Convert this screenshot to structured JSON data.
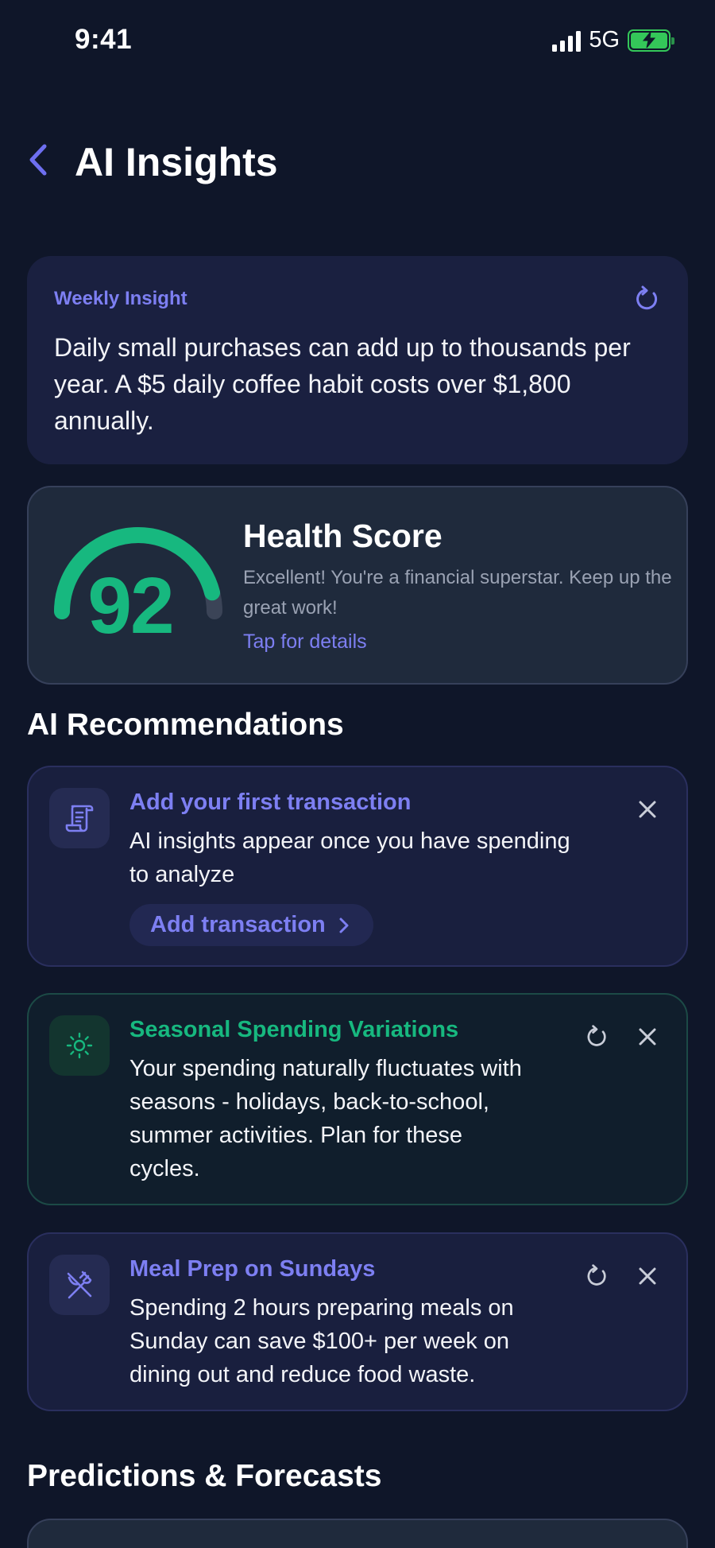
{
  "status_bar": {
    "time": "9:41",
    "network": "5G"
  },
  "header": {
    "title": "AI Insights"
  },
  "weekly_insight": {
    "label": "Weekly Insight",
    "text": "Daily small purchases can add up to thousands per year. A $5 daily coffee habit costs over $1,800 annually."
  },
  "health_score": {
    "score": "92",
    "score_fraction": 0.92,
    "title": "Health Score",
    "description": "Excellent! You're a financial superstar. Keep up the great work!",
    "link": "Tap for details"
  },
  "recommendations": {
    "section_title": "AI Recommendations",
    "items": [
      {
        "icon": "receipt-icon",
        "title": "Add your first transaction",
        "body_lines": [
          "AI insights appear once you have spending",
          "to analyze"
        ],
        "action_label": "Add transaction"
      },
      {
        "icon": "sun-icon",
        "title": "Seasonal Spending Variations",
        "body_lines": [
          "Your spending naturally fluctuates with",
          "seasons - holidays, back-to-school,",
          "summer activities. Plan for these",
          "cycles."
        ]
      },
      {
        "icon": "utensils-icon",
        "title": "Meal Prep on Sundays",
        "body_lines": [
          "Spending 2 hours preparing meals on",
          "Sunday can save $100+ per week on",
          "dining out and reduce food waste."
        ]
      }
    ]
  },
  "predictions": {
    "section_title": "Predictions & Forecasts"
  },
  "colors": {
    "accent": "#7d7ff2",
    "success": "#17b87f",
    "background": "#0f1629"
  }
}
